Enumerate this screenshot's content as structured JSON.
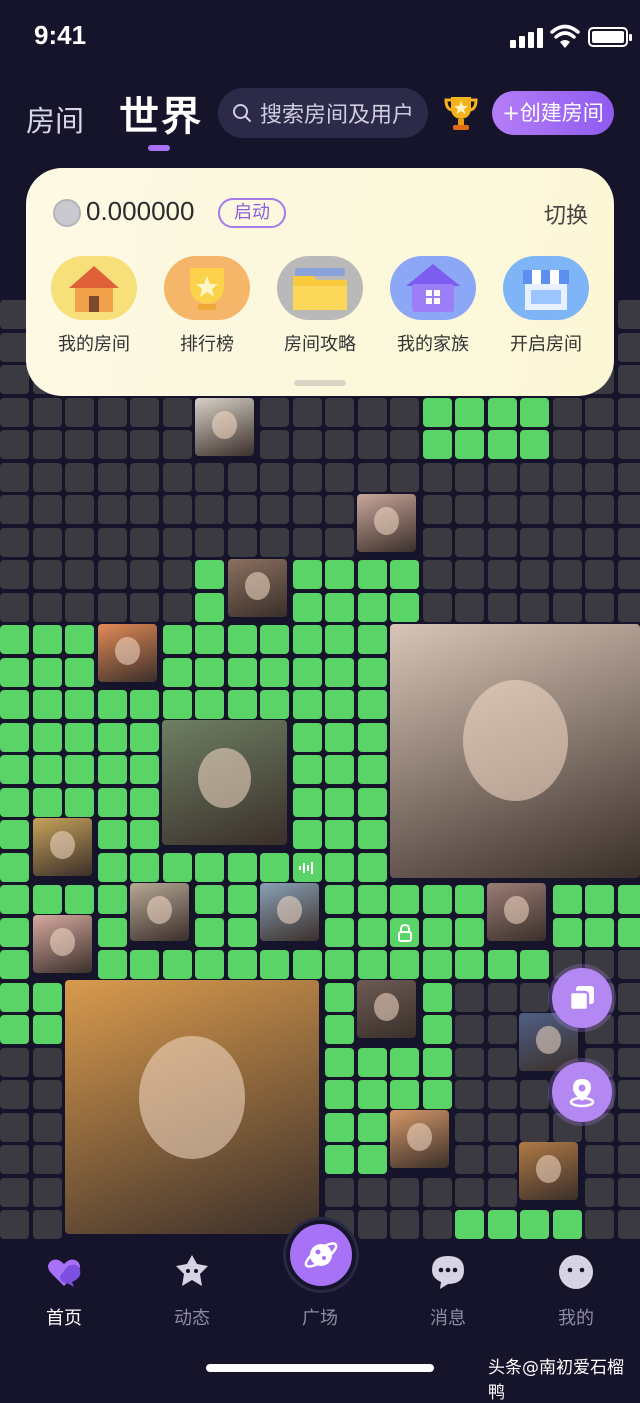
{
  "status": {
    "time": "9:41"
  },
  "header": {
    "tab_room": "房间",
    "tab_world": "世界",
    "search_placeholder": "搜索房间及用户",
    "create_label": "+创建房间"
  },
  "card": {
    "balance": "0.000000",
    "start_label": "启动",
    "switch_label": "切换",
    "quick_actions": [
      {
        "label": "我的房间",
        "icon": "house-icon"
      },
      {
        "label": "排行榜",
        "icon": "trophy-cup-icon"
      },
      {
        "label": "房间攻略",
        "icon": "folder-icon"
      },
      {
        "label": "我的家族",
        "icon": "family-home-icon"
      },
      {
        "label": "开启房间",
        "icon": "shop-icon"
      }
    ]
  },
  "colors": {
    "background": "#15142a",
    "cell_empty": "#3a3a40",
    "cell_active": "#5ad466",
    "accent": "#a772f5"
  },
  "tabbar": {
    "items": [
      {
        "label": "首页",
        "icon": "heart-chat-icon",
        "active": true
      },
      {
        "label": "动态",
        "icon": "star-bubble-icon",
        "active": false
      },
      {
        "label": "广场",
        "icon": "planet-icon",
        "active": false
      },
      {
        "label": "消息",
        "icon": "message-icon",
        "active": false
      },
      {
        "label": "我的",
        "icon": "face-icon",
        "active": false
      }
    ]
  },
  "watermark": "头条@南初爱石榴鸭"
}
